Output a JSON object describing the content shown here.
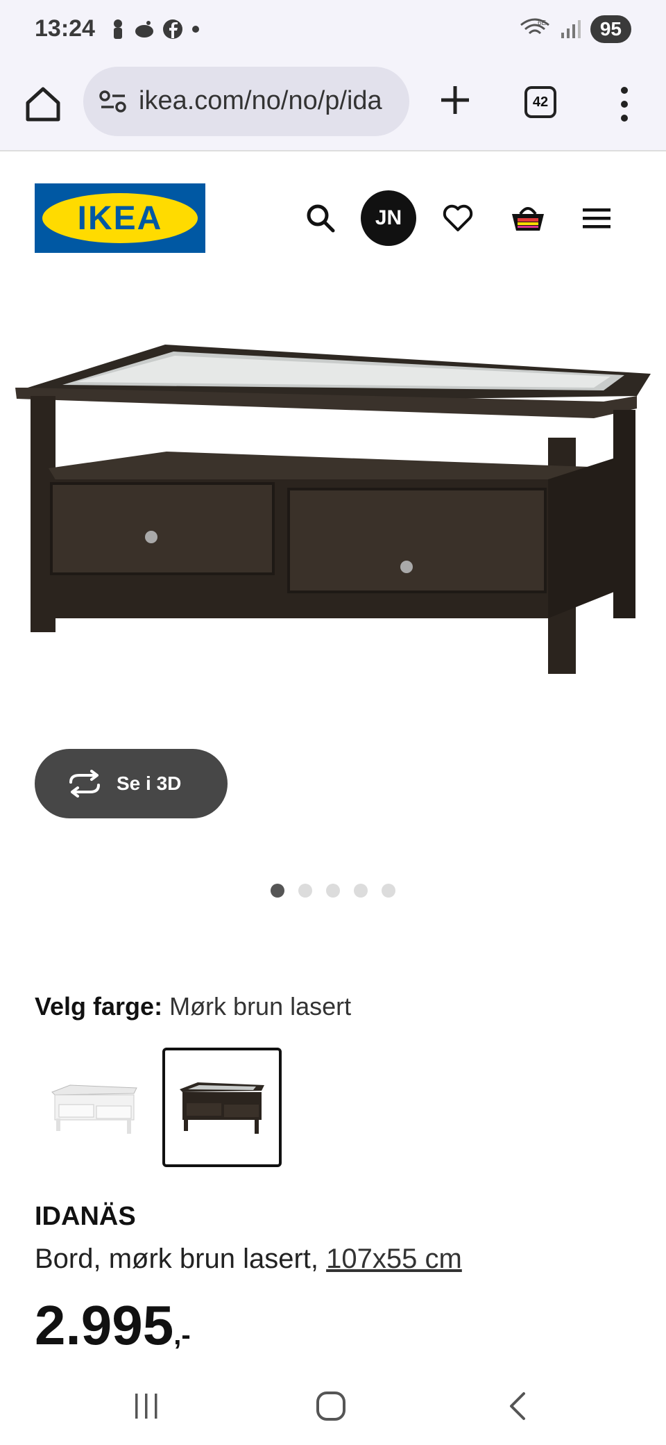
{
  "status_bar": {
    "time": "13:24",
    "battery": "95",
    "icons": [
      "person-icon",
      "bird-icon",
      "facebook-icon",
      "dot-icon",
      "wifi-6e-icon",
      "signal-icon"
    ]
  },
  "browser": {
    "url": "ikea.com/no/no/p/ida",
    "tab_count": "42"
  },
  "header": {
    "logo_text": "IKEA",
    "avatar_initials": "JN",
    "colors": {
      "logo_blue": "#0058a3",
      "logo_yellow": "#ffdb00"
    }
  },
  "gallery": {
    "see_3d_label": "Se i 3D",
    "dot_count": 5,
    "active_dot": 0
  },
  "color_picker": {
    "label": "Velg farge:",
    "value": "Mørk brun lasert",
    "options": [
      "white",
      "dark-brown"
    ],
    "selected": 1
  },
  "product": {
    "name": "IDANÄS",
    "description": "Bord, mørk brun lasert, ",
    "dimensions": "107x55 cm",
    "price": "2.995",
    "price_suffix": ",-"
  }
}
